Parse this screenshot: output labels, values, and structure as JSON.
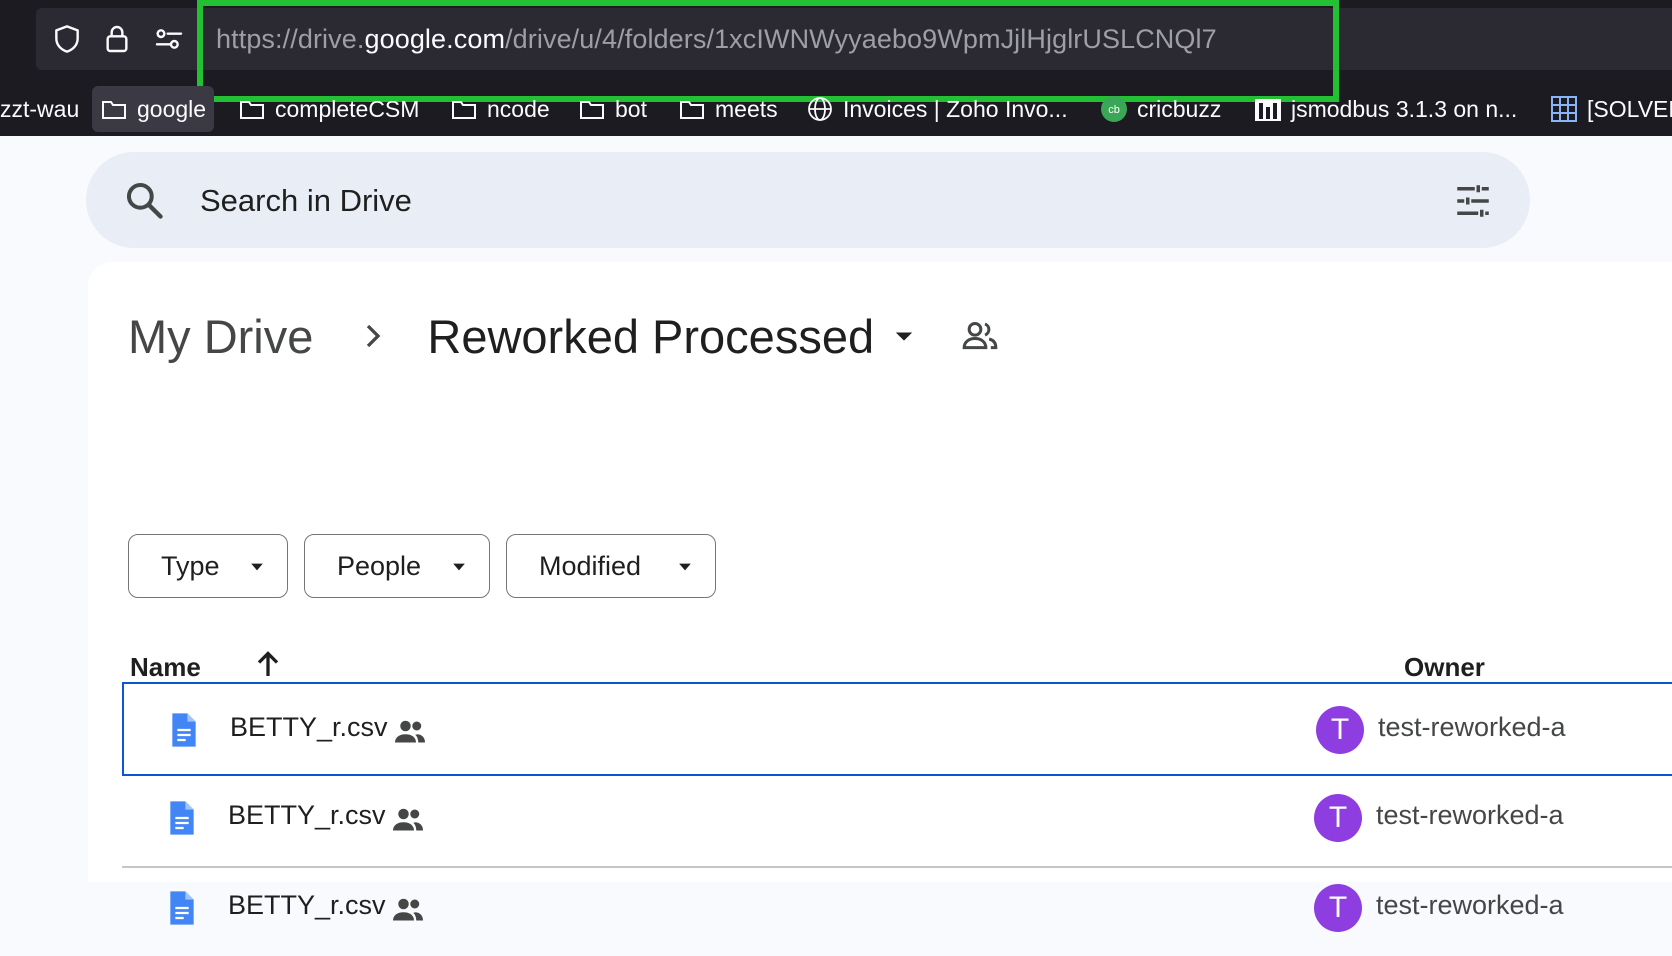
{
  "browser": {
    "url_scheme": "https://drive.",
    "url_host": "google.com",
    "url_path": "/drive/u/4/folders/1xcIWNWyyaebo9WpmJjlHjglrUSLCNQl7",
    "highlight_color": "#22c032",
    "icons": [
      "shield-icon",
      "lock-icon",
      "permissions-icon"
    ],
    "bookmarks": [
      {
        "label": "zzt-wau",
        "icon": "none"
      },
      {
        "label": "google",
        "icon": "folder-icon"
      },
      {
        "label": "completeCSM",
        "icon": "folder-icon"
      },
      {
        "label": "ncode",
        "icon": "folder-icon"
      },
      {
        "label": "bot",
        "icon": "folder-icon"
      },
      {
        "label": "meets",
        "icon": "folder-icon"
      },
      {
        "label": "Invoices | Zoho Invo...",
        "icon": "globe-icon"
      },
      {
        "label": "cricbuzz",
        "icon": "cricbuzz-icon"
      },
      {
        "label": "jsmodbus 3.1.3 on n...",
        "icon": "npm-icon"
      },
      {
        "label": "[SOLVED",
        "icon": "grid-icon"
      }
    ]
  },
  "search": {
    "placeholder": "Search in Drive"
  },
  "breadcrumb": {
    "root": "My Drive",
    "current": "Reworked Processed"
  },
  "filters": [
    "Type",
    "People",
    "Modified"
  ],
  "table": {
    "col_name": "Name",
    "col_owner": "Owner",
    "sort": "ascending",
    "rows": [
      {
        "name": "BETTY_r.csv",
        "avatar": "T",
        "owner": "test-reworked-a",
        "selected": true
      },
      {
        "name": "BETTY_r.csv",
        "avatar": "T",
        "owner": "test-reworked-a",
        "selected": false
      },
      {
        "name": "BETTY_r.csv",
        "avatar": "T",
        "owner": "test-reworked-a",
        "selected": false
      }
    ]
  },
  "colors": {
    "selected_border": "#0b57d0",
    "avatar": "#8e3ee0",
    "file_icon": "#4285f4"
  }
}
